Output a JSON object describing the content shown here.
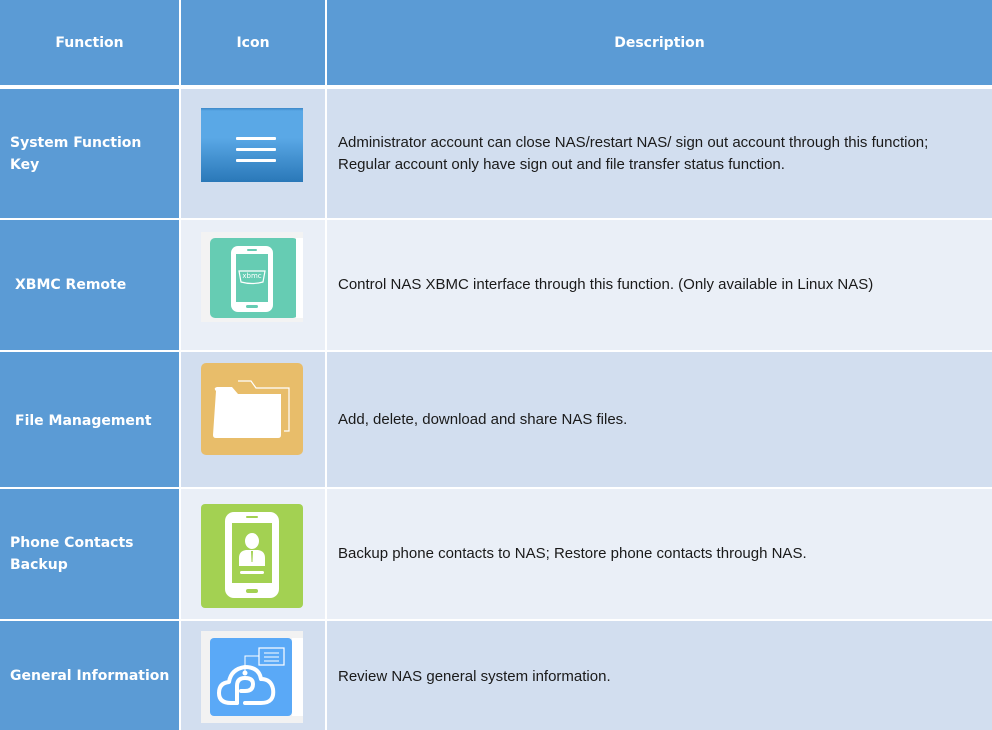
{
  "table": {
    "headers": {
      "function": "Function",
      "icon": "Icon",
      "description": "Description"
    },
    "rows": [
      {
        "function": "System Function Key",
        "icon": "menu-icon",
        "description": "Administrator account can close NAS/restart NAS/ sign out account through this function; Regular account only have sign out and file transfer status function."
      },
      {
        "function": "XBMC Remote",
        "icon": "xbmc-phone-icon",
        "icon_text": "xbmc",
        "description": "Control NAS XBMC interface through this function. (Only available in Linux NAS)"
      },
      {
        "function": "File Management",
        "icon": "folder-icon",
        "description": "Add, delete, download and share NAS files."
      },
      {
        "function": "Phone Contacts Backup",
        "icon": "contacts-phone-icon",
        "description": "Backup phone contacts to NAS; Restore phone contacts through NAS."
      },
      {
        "function": "General Information",
        "icon": "cloud-info-icon",
        "description": "Review NAS general system information."
      }
    ]
  },
  "colors": {
    "header_bg": "#5b9bd5",
    "row_odd_bg": "#d2deef",
    "row_even_bg": "#eaeff7",
    "menu_icon": "#4a9fe0",
    "xbmc_icon": "#66ccb3",
    "folder_icon": "#e8bd6a",
    "contacts_icon": "#a3d152",
    "cloud_icon": "#5aa9f7"
  }
}
